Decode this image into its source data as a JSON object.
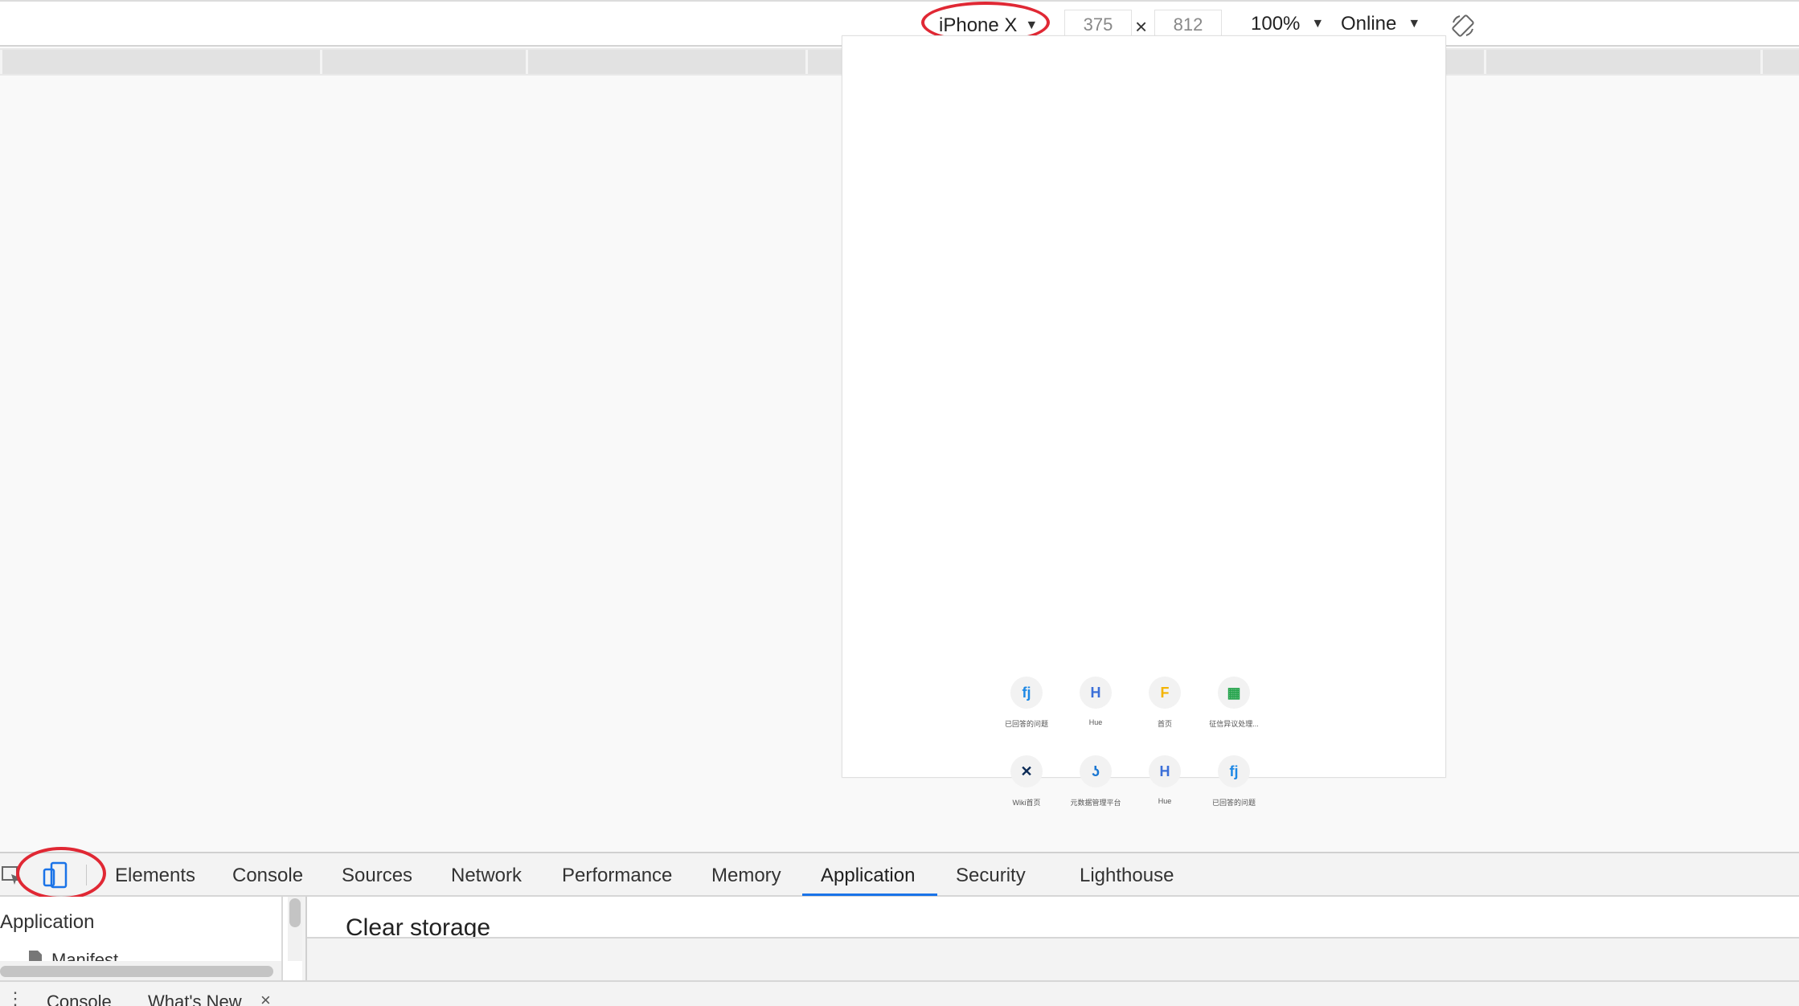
{
  "device_toolbar": {
    "device": "iPhone X",
    "width": "375",
    "height": "812",
    "separator": "×",
    "zoom": "100%",
    "throttling": "Online",
    "caret": "▼",
    "rotate_icon": "rotate-icon"
  },
  "viewport": {
    "apps": [
      {
        "label": "已回答的问题",
        "icon": "fj",
        "color": "#1e88e5"
      },
      {
        "label": "Hue",
        "icon": "H",
        "color": "#3b6fd8"
      },
      {
        "label": "首页",
        "icon": "F",
        "color": "#f4b400"
      },
      {
        "label": "征信异议处理...",
        "icon": "▦",
        "color": "#22a34a"
      },
      {
        "label": "Wiki首页",
        "icon": "✕",
        "color": "#0b2a56"
      },
      {
        "label": "元数据管理平台",
        "icon": "ʖ",
        "color": "#1976d2"
      },
      {
        "label": "Hue",
        "icon": "H",
        "color": "#3b6fd8"
      },
      {
        "label": "已回答的问题",
        "icon": "fj",
        "color": "#1e88e5"
      }
    ]
  },
  "devtools": {
    "tabs": [
      "Elements",
      "Console",
      "Sources",
      "Network",
      "Performance",
      "Memory",
      "Application",
      "Security",
      "Lighthouse"
    ],
    "active_tab": "Application",
    "accent": "#1a73e8",
    "sidebar": {
      "title": "Application",
      "item": "Manifest"
    },
    "main": {
      "title": "Clear storage"
    },
    "drawer": {
      "tabs": [
        "Console",
        "What's New"
      ],
      "close": "×",
      "menu": "⋮"
    }
  },
  "annotations": {
    "highlight_color": "#e02834"
  }
}
